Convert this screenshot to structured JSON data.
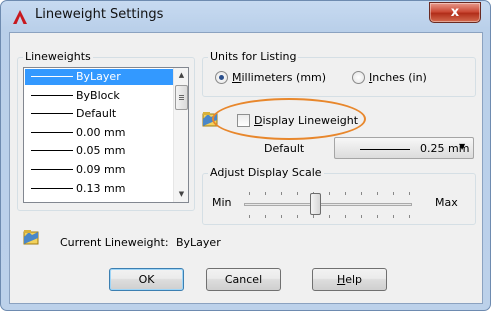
{
  "window": {
    "title": "Lineweight Settings",
    "close_glyph": "x"
  },
  "lineweights": {
    "group_label": "Lineweights",
    "items": [
      {
        "label": "ByLayer",
        "selected": true
      },
      {
        "label": "ByBlock",
        "selected": false
      },
      {
        "label": "Default",
        "selected": false
      },
      {
        "label": "0.00 mm",
        "selected": false
      },
      {
        "label": "0.05 mm",
        "selected": false
      },
      {
        "label": "0.09 mm",
        "selected": false
      },
      {
        "label": "0.13 mm",
        "selected": false
      }
    ],
    "scroll_up_glyph": "▲",
    "scroll_down_glyph": "▼"
  },
  "units": {
    "group_label": "Units for Listing",
    "millimeters": {
      "prefix": "",
      "mnemonic": "M",
      "rest": "illimeters (mm)",
      "checked": true
    },
    "inches": {
      "prefix": "",
      "mnemonic": "I",
      "rest": "nches (in)",
      "checked": false
    }
  },
  "display_lineweight": {
    "prefix": "",
    "mnemonic": "D",
    "rest": "isplay Lineweight",
    "checked": false
  },
  "default_setting": {
    "label": "Default",
    "value": "0.25 mm",
    "arrow_glyph": "▼"
  },
  "display_scale": {
    "group_label": "Adjust Display Scale",
    "min_label": "Min",
    "max_label": "Max",
    "level": 0.42
  },
  "current": {
    "label": "Current Lineweight:",
    "value": "ByLayer"
  },
  "buttons": {
    "ok": "OK",
    "cancel": "Cancel",
    "help_mnemonic": "H",
    "help_rest": "elp"
  },
  "icons": {
    "title": "autocad-a-icon",
    "display": "lineweight-display-icon",
    "current": "current-lineweight-icon"
  },
  "colors": {
    "selection": "#3399ff",
    "highlight": "#e8872c",
    "close": "#c8432e"
  }
}
